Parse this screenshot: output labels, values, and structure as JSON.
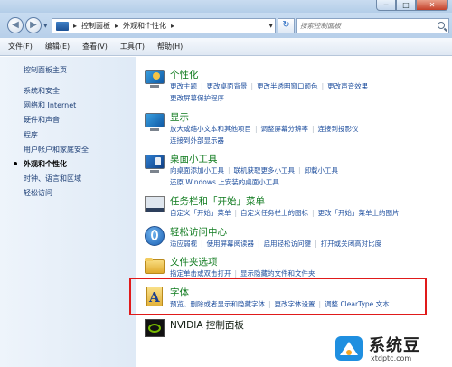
{
  "window": {
    "minimize": "─",
    "maximize": "□",
    "close": "✕"
  },
  "nav": {
    "back_icon": "arrow-left-icon",
    "forward_icon": "arrow-right-icon",
    "address_segments": [
      "控制面板",
      "外观和个性化"
    ],
    "search_placeholder": "搜索控制面板"
  },
  "menu": [
    "文件(F)",
    "编辑(E)",
    "查看(V)",
    "工具(T)",
    "帮助(H)"
  ],
  "sidebar": {
    "title": "控制面板主页",
    "items": [
      {
        "label": "系统和安全",
        "active": false
      },
      {
        "label": "网络和 Internet",
        "active": false
      },
      {
        "label": "硬件和声音",
        "active": false
      },
      {
        "label": "程序",
        "active": false
      },
      {
        "label": "用户帐户和家庭安全",
        "active": false
      },
      {
        "label": "外观和个性化",
        "active": true
      },
      {
        "label": "时钟、语言和区域",
        "active": false
      },
      {
        "label": "轻松访问",
        "active": false
      }
    ]
  },
  "categories": [
    {
      "title": "个性化",
      "icon": "personalization-icon",
      "links": [
        [
          "更改主题",
          "更改桌面背景",
          "更改半透明窗口颜色",
          "更改声音效果"
        ],
        [
          "更改屏幕保护程序"
        ]
      ]
    },
    {
      "title": "显示",
      "icon": "display-icon",
      "links": [
        [
          "放大或缩小文本和其他项目",
          "调整屏幕分辨率",
          "连接到投影仪"
        ],
        [
          "连接到外部显示器"
        ]
      ]
    },
    {
      "title": "桌面小工具",
      "icon": "gadgets-icon",
      "links": [
        [
          "向桌面添加小工具",
          "联机获取更多小工具",
          "卸载小工具"
        ],
        [
          "还原 Windows 上安装的桌面小工具"
        ]
      ]
    },
    {
      "title": "任务栏和「开始」菜单",
      "icon": "taskbar-icon",
      "links": [
        [
          "自定义「开始」菜单",
          "自定义任务栏上的图标",
          "更改「开始」菜单上的图片"
        ]
      ]
    },
    {
      "title": "轻松访问中心",
      "icon": "ease-of-access-icon",
      "links": [
        [
          "适应弱视",
          "使用屏幕阅读器",
          "启用轻松访问键",
          "打开或关闭高对比度"
        ]
      ]
    },
    {
      "title": "文件夹选项",
      "icon": "folder-options-icon",
      "links": [
        [
          "指定单击或双击打开",
          "显示隐藏的文件和文件夹"
        ]
      ]
    },
    {
      "title": "字体",
      "icon": "fonts-icon",
      "links": [
        [
          "预览、删除或者显示和隐藏字体",
          "更改字体设置",
          "调整 ClearType 文本"
        ]
      ]
    },
    {
      "title": "NVIDIA 控制面板",
      "icon": "nvidia-icon",
      "links": []
    }
  ],
  "watermark": {
    "text": "系统豆",
    "url": "xtdptc.com"
  },
  "colors": {
    "category_title": "#0e7a1d",
    "link": "#1f4f9e",
    "highlight": "#e01a1a"
  }
}
